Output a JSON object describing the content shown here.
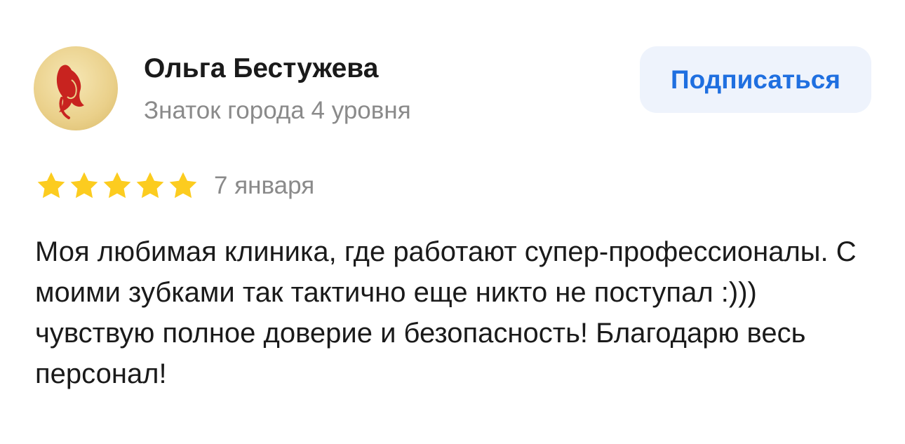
{
  "review": {
    "author": {
      "name": "Ольга Бестужева",
      "level": "Знаток города 4 уровня",
      "avatar_icon": "woman-silhouette-avatar"
    },
    "subscribe_label": "Подписаться",
    "rating": 5,
    "rating_max": 5,
    "star_icon": "star-icon",
    "date": "7 января",
    "text": "Моя любимая клиника, где работают супер-профессионалы. С моими зубками так тактично еще никто не поступал :))) чувствую полное доверие и безопасность! Благодарю весь персонал!"
  },
  "colors": {
    "accent": "#1f6fe0",
    "button_bg": "#eef3fc",
    "star": "#fccc1f",
    "muted_text": "#8a8a8a",
    "text": "#1a1a1a"
  }
}
